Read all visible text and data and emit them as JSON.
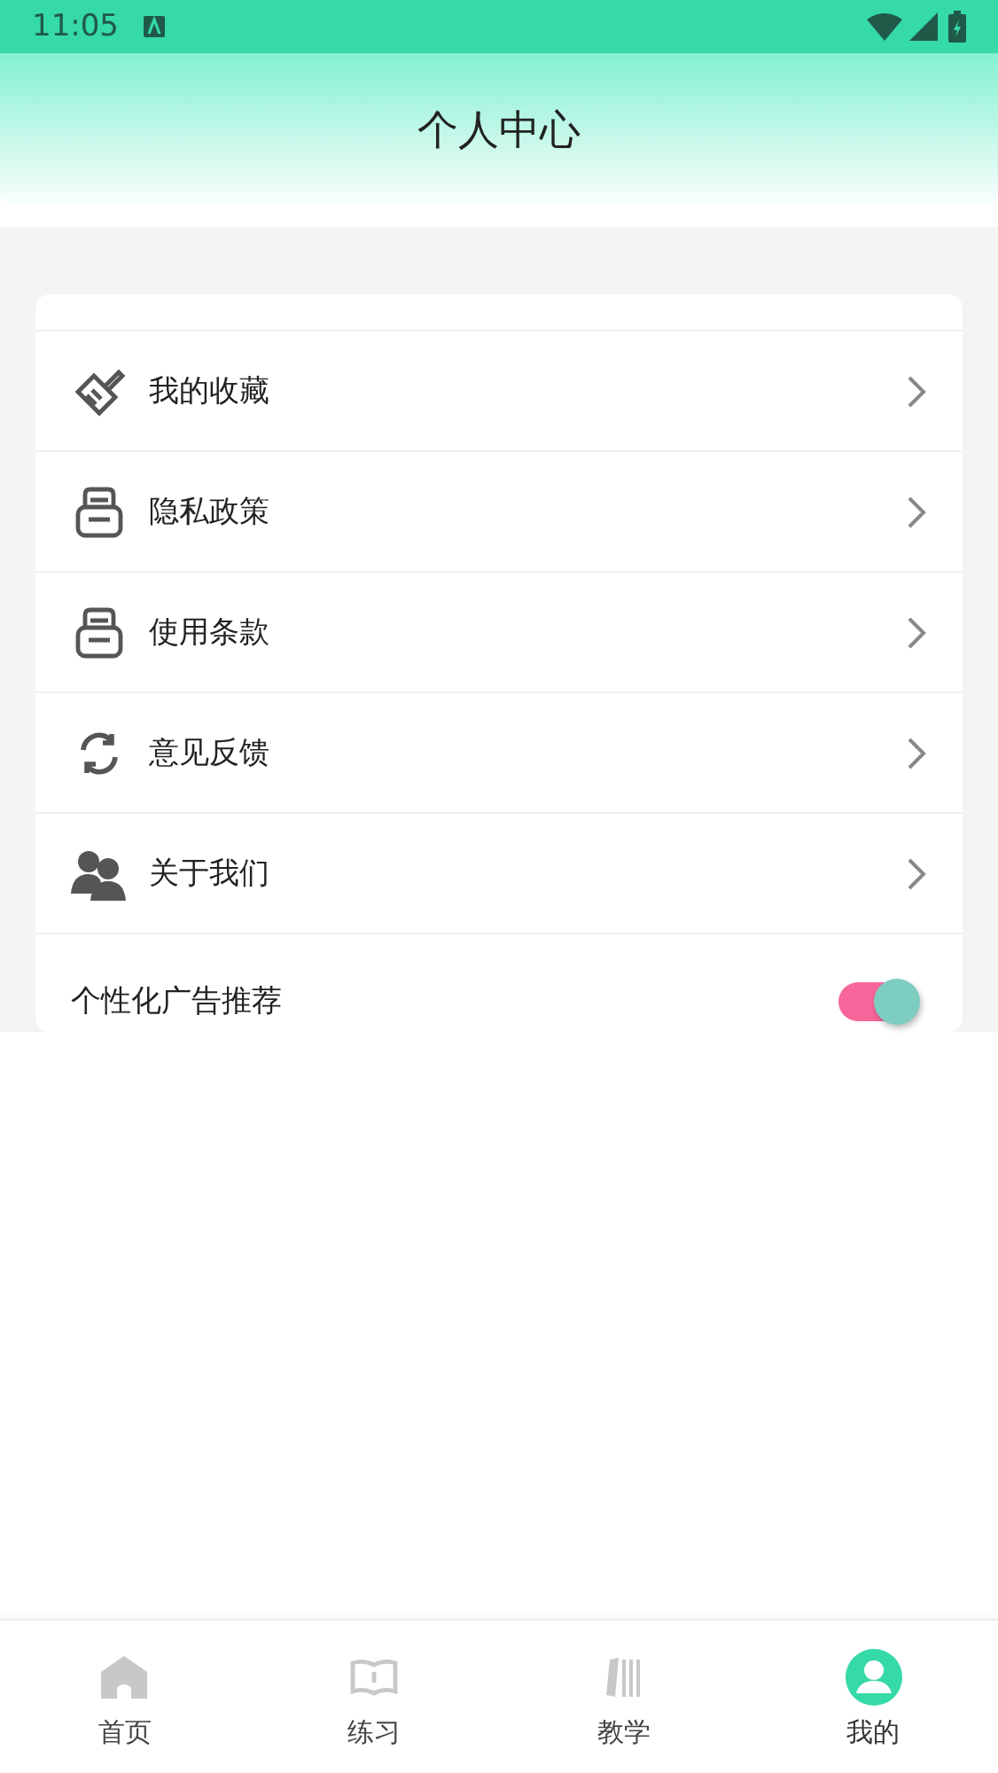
{
  "status_bar": {
    "time": "11:05"
  },
  "header": {
    "title": "个人中心"
  },
  "menu": [
    {
      "kind": "brush",
      "label": "我的收藏"
    },
    {
      "kind": "tray",
      "label": "隐私政策"
    },
    {
      "kind": "tray",
      "label": "使用条款"
    },
    {
      "kind": "refresh",
      "label": "意见反馈"
    },
    {
      "kind": "people",
      "label": "关于我们"
    }
  ],
  "ad_setting": {
    "label": "个性化广告推荐",
    "on": true
  },
  "bottom_nav": [
    {
      "kind": "home",
      "label": "首页",
      "selected": false
    },
    {
      "kind": "book",
      "label": "练习",
      "selected": false
    },
    {
      "kind": "books",
      "label": "教学",
      "selected": false
    },
    {
      "kind": "user",
      "label": "我的",
      "selected": true
    }
  ]
}
